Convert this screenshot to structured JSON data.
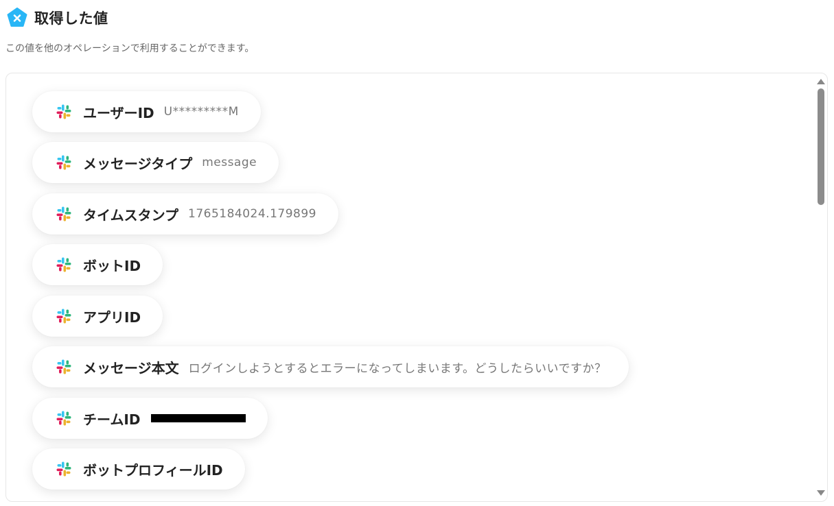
{
  "header": {
    "title": "取得した値",
    "logo_icon": "yoom-pentagon-icon",
    "accent": "#29b6f6"
  },
  "subtitle": "この値を他のオペレーションで利用することができます。",
  "items": [
    {
      "label": "ユーザーID",
      "value": "U*********M",
      "icon": "slack-icon"
    },
    {
      "label": "メッセージタイプ",
      "value": "message",
      "icon": "slack-icon"
    },
    {
      "label": "タイムスタンプ",
      "value": "1765184024.179899",
      "icon": "slack-icon"
    },
    {
      "label": "ボットID",
      "value": "",
      "icon": "slack-icon"
    },
    {
      "label": "アプリID",
      "value": "",
      "icon": "slack-icon"
    },
    {
      "label": "メッセージ本文",
      "value": "ログインしようとするとエラーになってしまいます。どうしたらいいですか？",
      "icon": "slack-icon"
    },
    {
      "label": "チームID",
      "value": "",
      "redacted": true,
      "icon": "slack-icon"
    },
    {
      "label": "ボットプロフィールID",
      "value": "",
      "icon": "slack-icon"
    }
  ]
}
